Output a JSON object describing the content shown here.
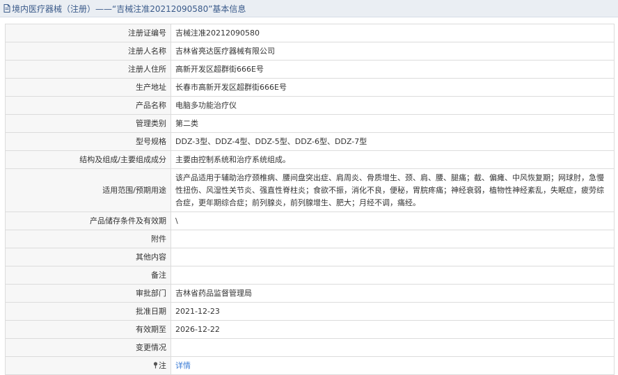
{
  "header": {
    "title": "境内医疗器械（注册）——“吉械注准20212090580”基本信息"
  },
  "rows": [
    {
      "label": "注册证编号",
      "value": "吉械注准20212090580"
    },
    {
      "label": "注册人名称",
      "value": "吉林省亮达医疗器械有限公司"
    },
    {
      "label": "注册人住所",
      "value": "高新开发区超群街666E号"
    },
    {
      "label": "生产地址",
      "value": "长春市高新开发区超群街666E号"
    },
    {
      "label": "产品名称",
      "value": "电脑多功能治疗仪"
    },
    {
      "label": "管理类别",
      "value": "第二类"
    },
    {
      "label": "型号规格",
      "value": "DDZ-3型、DDZ-4型、DDZ-5型、DDZ-6型、DDZ-7型"
    },
    {
      "label": "结构及组成/主要组成成分",
      "value": "主要由控制系统和治疗系统组成。"
    },
    {
      "label": "适用范围/预期用途",
      "value": "该产品适用于辅助治疗颈椎病、腰间盘突出症、肩周炎、骨质增生、颈、肩、腰、腿痛；截、偏瘫、中风恢复期；网球肘，急慢性扭伤、风湿性关节炎、强直性脊柱炎；食欲不振，消化不良，便秘，胃脘疼痛；神经衰弱，植物性神经紊乱，失眠症，疲劳综合症，更年期综合症；前列腺炎，前列腺增生、肥大；月经不调，痛经。"
    },
    {
      "label": "产品储存条件及有效期",
      "value": "\\"
    },
    {
      "label": "附件",
      "value": ""
    },
    {
      "label": "其他内容",
      "value": ""
    },
    {
      "label": "备注",
      "value": ""
    },
    {
      "label": "审批部门",
      "value": "吉林省药品监督管理局"
    },
    {
      "label": "批准日期",
      "value": "2021-12-23"
    },
    {
      "label": "有效期至",
      "value": "2026-12-22"
    },
    {
      "label": "变更情况",
      "value": ""
    },
    {
      "label": "注",
      "value": "详情"
    }
  ],
  "icons": {
    "header": "document-icon",
    "note": "pin-icon"
  },
  "colors": {
    "header_text": "#3a5a8a",
    "link": "#3a7bd5",
    "label_bg": "#f7f7f7",
    "border": "#dcdcdc"
  }
}
